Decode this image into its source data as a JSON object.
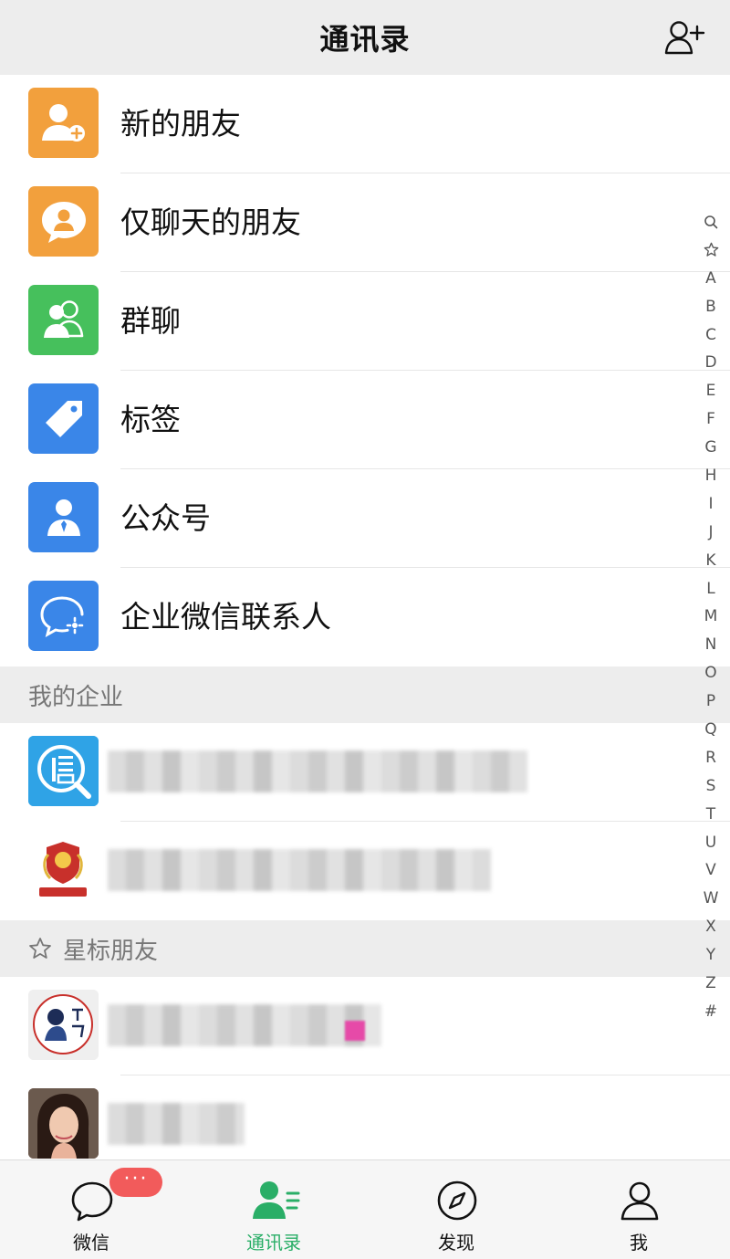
{
  "header": {
    "title": "通讯录",
    "add_icon": "add-contact-icon"
  },
  "functions": [
    {
      "label": "新的朋友",
      "icon": "new-friend-icon",
      "color": "#f2a03d"
    },
    {
      "label": "仅聊天的朋友",
      "icon": "chat-only-friend-icon",
      "color": "#f2a03d"
    },
    {
      "label": "群聊",
      "icon": "group-chat-icon",
      "color": "#46c05c"
    },
    {
      "label": "标签",
      "icon": "tag-icon",
      "color": "#3a86e8"
    },
    {
      "label": "公众号",
      "icon": "official-account-icon",
      "color": "#3a86e8"
    },
    {
      "label": "企业微信联系人",
      "icon": "wecom-contact-icon",
      "color": "#3a86e8"
    }
  ],
  "sections": {
    "my_enterprise": "我的企业",
    "starred": "星标朋友"
  },
  "index_bar": [
    "A",
    "B",
    "C",
    "D",
    "E",
    "F",
    "G",
    "H",
    "I",
    "J",
    "K",
    "L",
    "M",
    "N",
    "O",
    "P",
    "Q",
    "R",
    "S",
    "T",
    "U",
    "V",
    "W",
    "X",
    "Y",
    "Z",
    "#"
  ],
  "tabs": [
    {
      "label": "微信",
      "icon": "chat-bubble-icon",
      "badge": "···"
    },
    {
      "label": "通讯录",
      "icon": "contacts-icon",
      "active": true
    },
    {
      "label": "发现",
      "icon": "compass-icon"
    },
    {
      "label": "我",
      "icon": "profile-icon"
    }
  ],
  "colors": {
    "accent": "#2aae67",
    "badge": "#f25b5b"
  }
}
